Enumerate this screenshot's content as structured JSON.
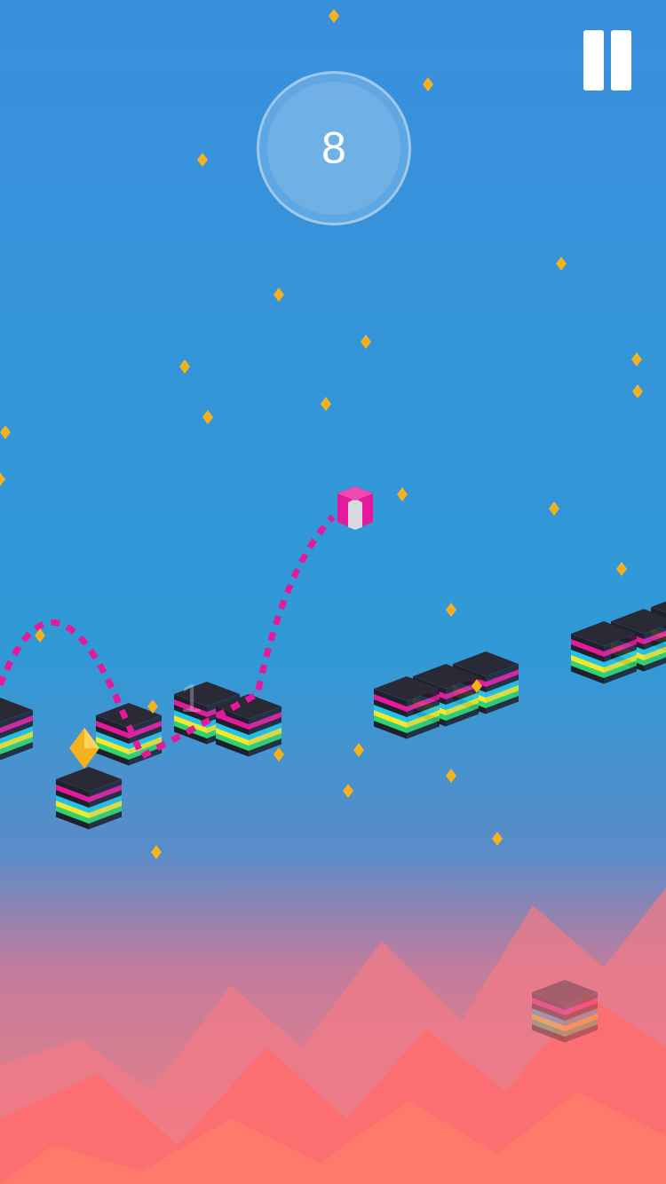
{
  "score": "8",
  "combo": "1"
}
